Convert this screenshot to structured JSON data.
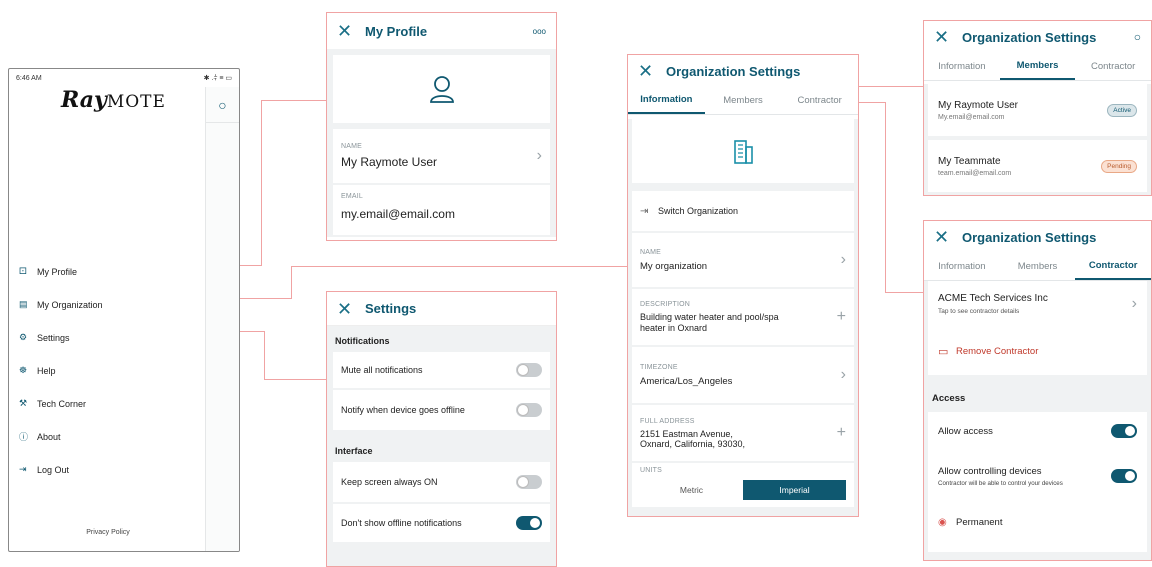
{
  "phone": {
    "time": "6:46 AM",
    "status_icons": "✱ .⫩ ≡ ▭",
    "logo": "RayMOTE",
    "menu": [
      {
        "label": "My Profile",
        "icon": "person-icon",
        "glyph": "⚀"
      },
      {
        "label": "My Organization",
        "icon": "building-icon",
        "glyph": "▤"
      },
      {
        "label": "Settings",
        "icon": "gear-icon",
        "glyph": "⚙"
      },
      {
        "label": "Help",
        "icon": "help-icon",
        "glyph": "☸"
      },
      {
        "label": "Tech Corner",
        "icon": "tools-icon",
        "glyph": "⚒"
      },
      {
        "label": "About",
        "icon": "info-icon",
        "glyph": "ⓘ"
      },
      {
        "label": "Log Out",
        "icon": "logout-icon",
        "glyph": "⇥"
      }
    ],
    "privacy": "Privacy Policy"
  },
  "profile": {
    "title": "My Profile",
    "more": "ooo",
    "name_label": "NAME",
    "name_value": "My Raymote User",
    "email_label": "EMAIL",
    "email_value": "my.email@email.com"
  },
  "settings": {
    "title": "Settings",
    "section_notifications": "Notifications",
    "mute": "Mute all notifications",
    "notify_offline": "Notify when device goes offline",
    "section_interface": "Interface",
    "keep_on": "Keep screen always ON",
    "dont_show": "Don't show offline notifications"
  },
  "org": {
    "title": "Organization Settings",
    "tabs": [
      "Information",
      "Members",
      "Contractor"
    ],
    "switch": "Switch Organization",
    "name_label": "NAME",
    "name_value": "My organization",
    "desc_label": "DESCRIPTION",
    "desc_value": "Building water heater and pool/spa heater in Oxnard",
    "tz_label": "TIMEZONE",
    "tz_value": "America/Los_Angeles",
    "addr_label": "FULL ADDRESS",
    "addr_line1": "2151 Eastman Avenue,",
    "addr_line2": "Oxnard, California, 93030,",
    "units_label": "UNITS",
    "units": [
      "Metric",
      "Imperial"
    ]
  },
  "members": {
    "title": "Organization Settings",
    "tabs": [
      "Information",
      "Members",
      "Contractor"
    ],
    "list": [
      {
        "name": "My Raymote User",
        "email": "My.email@email.com",
        "status": "Active"
      },
      {
        "name": "My Teammate",
        "email": "team.email@email.com",
        "status": "Pending"
      }
    ]
  },
  "contractor": {
    "title": "Organization Settings",
    "tabs": [
      "Information",
      "Members",
      "Contractor"
    ],
    "company": "ACME Tech Services Inc",
    "company_sub": "Tap to see contractor details",
    "remove": "Remove Contractor",
    "access_header": "Access",
    "allow_access": "Allow access",
    "allow_controlling": "Allow controlling devices",
    "allow_controlling_sub": "Contractor will be able to control your devices",
    "permanent": "Permanent"
  },
  "colors": {
    "accent": "#0f5870",
    "connector": "#f0a3a3",
    "remove": "#c0392b",
    "pending": "#f3c1a8",
    "active": "#d4e3e8"
  }
}
